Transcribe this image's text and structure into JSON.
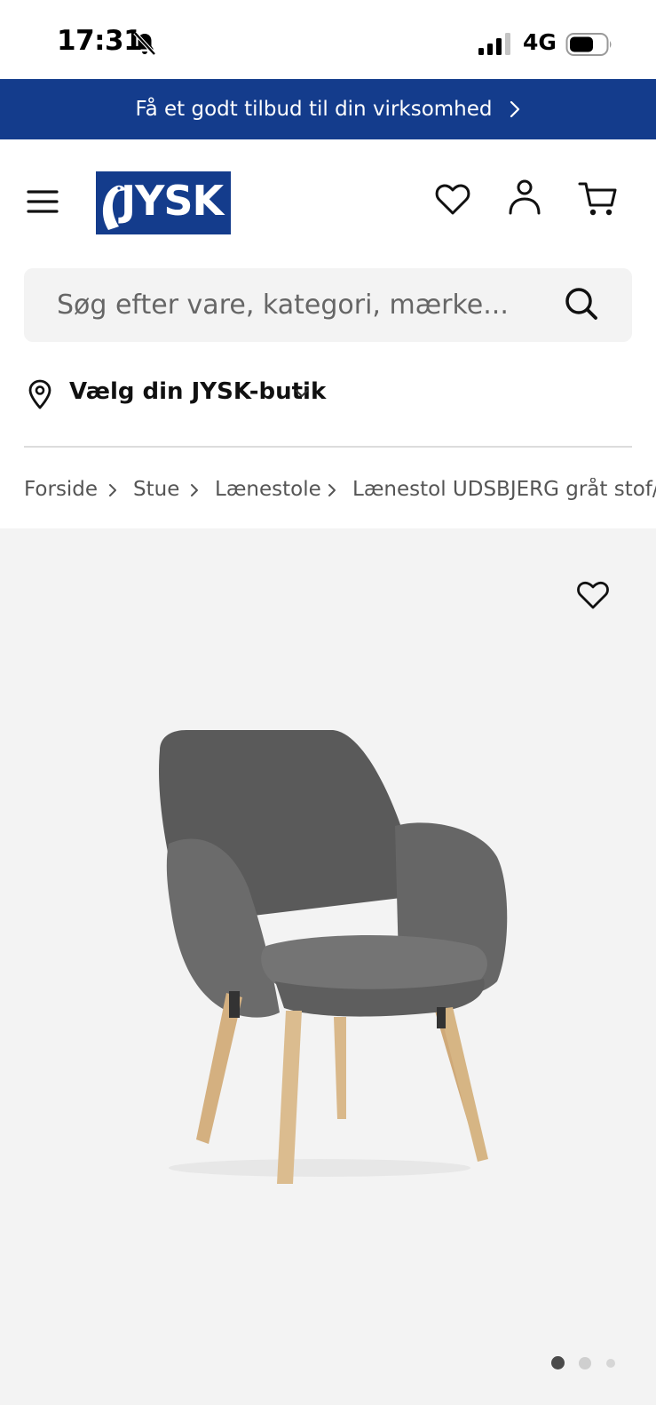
{
  "status_bar": {
    "time": "17:31",
    "network": "4G",
    "icons": [
      "bell-slash-icon",
      "signal-icon",
      "battery-icon"
    ]
  },
  "promo_banner": {
    "text": "Få et godt tilbud til din virksomhed",
    "icon": "chevron-right-icon",
    "background": "#143c8c"
  },
  "header": {
    "logo_text": "JYSK",
    "brand_color": "#143c8c",
    "icons": [
      "menu-icon",
      "heart-icon",
      "user-icon",
      "cart-icon"
    ]
  },
  "search": {
    "placeholder": "Søg efter vare, kategori, mærke...",
    "value": "",
    "icon": "search-icon"
  },
  "store_selector": {
    "label": "Vælg din JYSK-butik",
    "icon": "map-pin-icon"
  },
  "breadcrumb": {
    "items": [
      "Forside",
      "Stue",
      "Lænestole",
      "Lænestol UDSBJERG gråt stof/"
    ]
  },
  "gallery": {
    "product_image": "grey fabric armchair with light wooden legs",
    "favorite_icon": "heart-icon",
    "slide_count": 3,
    "active_slide": 1
  }
}
